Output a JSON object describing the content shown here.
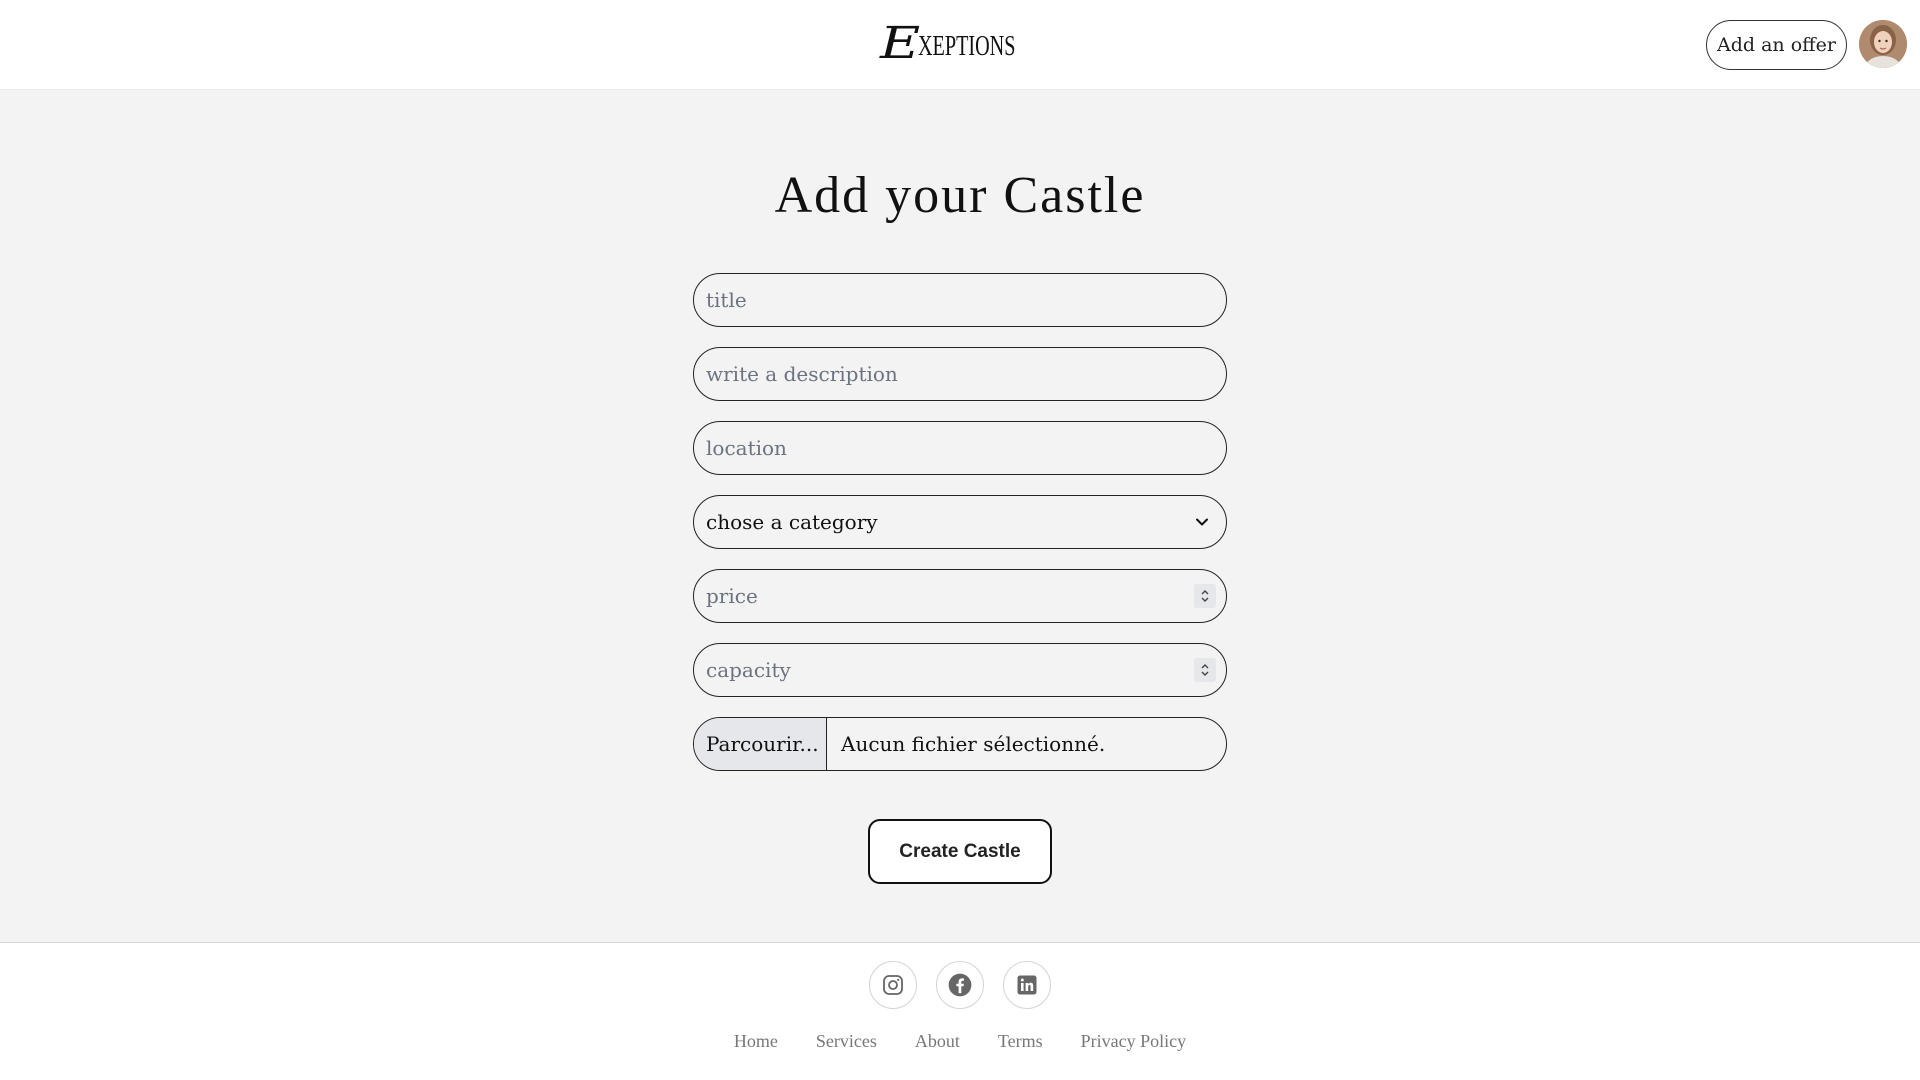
{
  "header": {
    "logo_initial": "E",
    "logo_rest": "XEPTIONS",
    "add_offer_label": "Add an offer",
    "avatar_icon": "user-avatar"
  },
  "form": {
    "title": "Add your Castle",
    "title_placeholder": "title",
    "description_placeholder": "write a description",
    "location_placeholder": "location",
    "category_selected": "chose a category",
    "price_placeholder": "price",
    "capacity_placeholder": "capacity",
    "file_button_label": "Parcourir...",
    "file_status": "Aucun fichier sélectionné.",
    "submit_label": "Create Castle"
  },
  "footer": {
    "social": [
      {
        "icon": "instagram-icon"
      },
      {
        "icon": "facebook-icon"
      },
      {
        "icon": "linkedin-icon"
      }
    ],
    "links": [
      "Home",
      "Services",
      "About",
      "Terms",
      "Privacy Policy"
    ]
  },
  "colors": {
    "background_main": "#f3f3f3",
    "border": "#222222",
    "footer_link": "#777777"
  }
}
